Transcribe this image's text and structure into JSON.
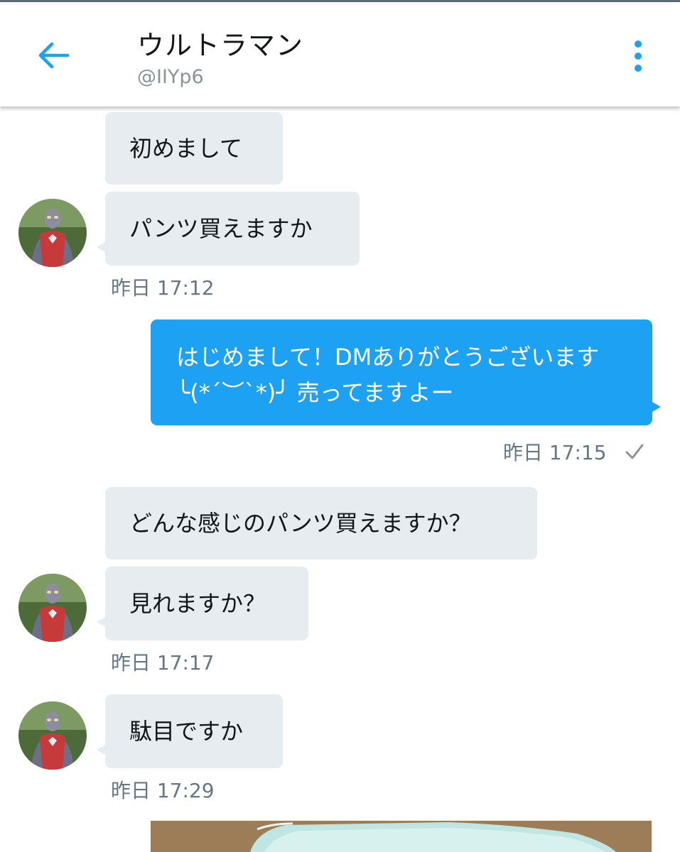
{
  "header": {
    "title": "ウルトラマン",
    "handle": "@IIYp6",
    "back_icon": "arrow-left-icon",
    "menu_icon": "more-vertical-icon",
    "accent_color": "#1da1f2"
  },
  "messages": [
    {
      "text": "初めまして",
      "from": "them"
    },
    {
      "text": "パンツ買えますか",
      "from": "them"
    },
    {
      "text": "はじめまして！DMありがとうございます ╰(*´︶`*)╯ 売ってますよー",
      "from": "me"
    },
    {
      "text": "どんな感じのパンツ買えますか？",
      "from": "them"
    },
    {
      "text": "見れますか？",
      "from": "them"
    },
    {
      "text": "駄目ですか",
      "from": "them"
    }
  ],
  "timestamps": [
    {
      "text": "昨日 17:12"
    },
    {
      "text": "昨日 17:15",
      "read_icon": "checkmark-icon"
    },
    {
      "text": "昨日 17:17"
    },
    {
      "text": "昨日 17:29"
    }
  ],
  "colors": {
    "received_bubble": "#e6ecf0",
    "sent_bubble": "#1da1f2",
    "timestamp": "#657786"
  }
}
